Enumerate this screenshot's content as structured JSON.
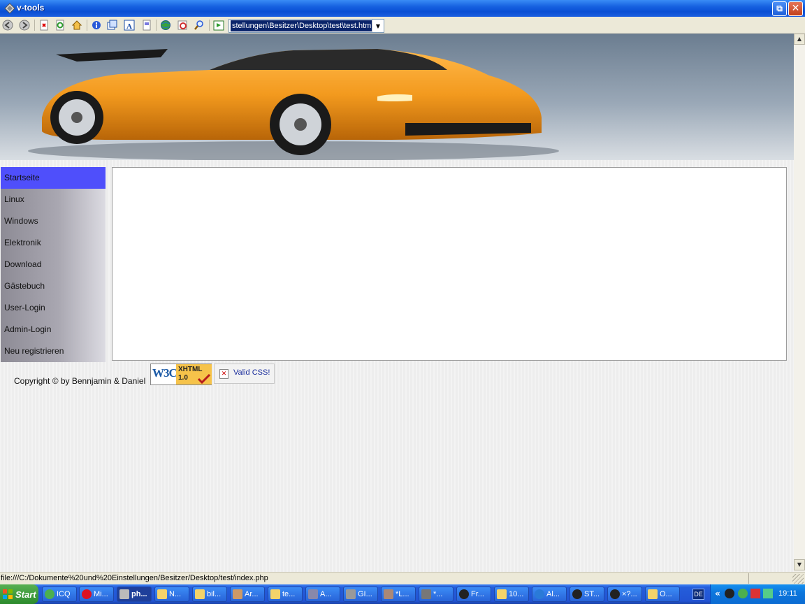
{
  "window": {
    "title": "v-tools"
  },
  "toolbar": {
    "address": "stellungen\\Besitzer\\Desktop\\test\\test.html"
  },
  "nav": {
    "items": [
      "Startseite",
      "Linux",
      "Windows",
      "Elektronik",
      "Download",
      "Gästebuch",
      "User-Login",
      "Admin-Login",
      "Neu registrieren"
    ],
    "active_index": 0
  },
  "footer": {
    "copyright": "Copyright © by Bennjamin & Daniel",
    "w3c_logo": "W3C",
    "w3c_badge": "XHTML",
    "w3c_version": "1.0",
    "css_badge": "Valid CSS!"
  },
  "statusbar": {
    "text": "file:///C:/Dokumente%20und%20Einstellungen/Besitzer/Desktop/test/index.php"
  },
  "taskbar": {
    "start": "Start",
    "tasks": [
      "ICQ",
      "Mi...",
      "ph...",
      "N...",
      "bil...",
      "Ar...",
      "te...",
      "A...",
      "GI...",
      "*L...",
      "*...",
      "Fr...",
      "10...",
      "Al...",
      "ST...",
      "×?...",
      "O..."
    ],
    "lang": "DE",
    "clock": "19:11"
  },
  "colors": {
    "nav_active": "#4f4ffb",
    "car": "#f39a1e"
  }
}
